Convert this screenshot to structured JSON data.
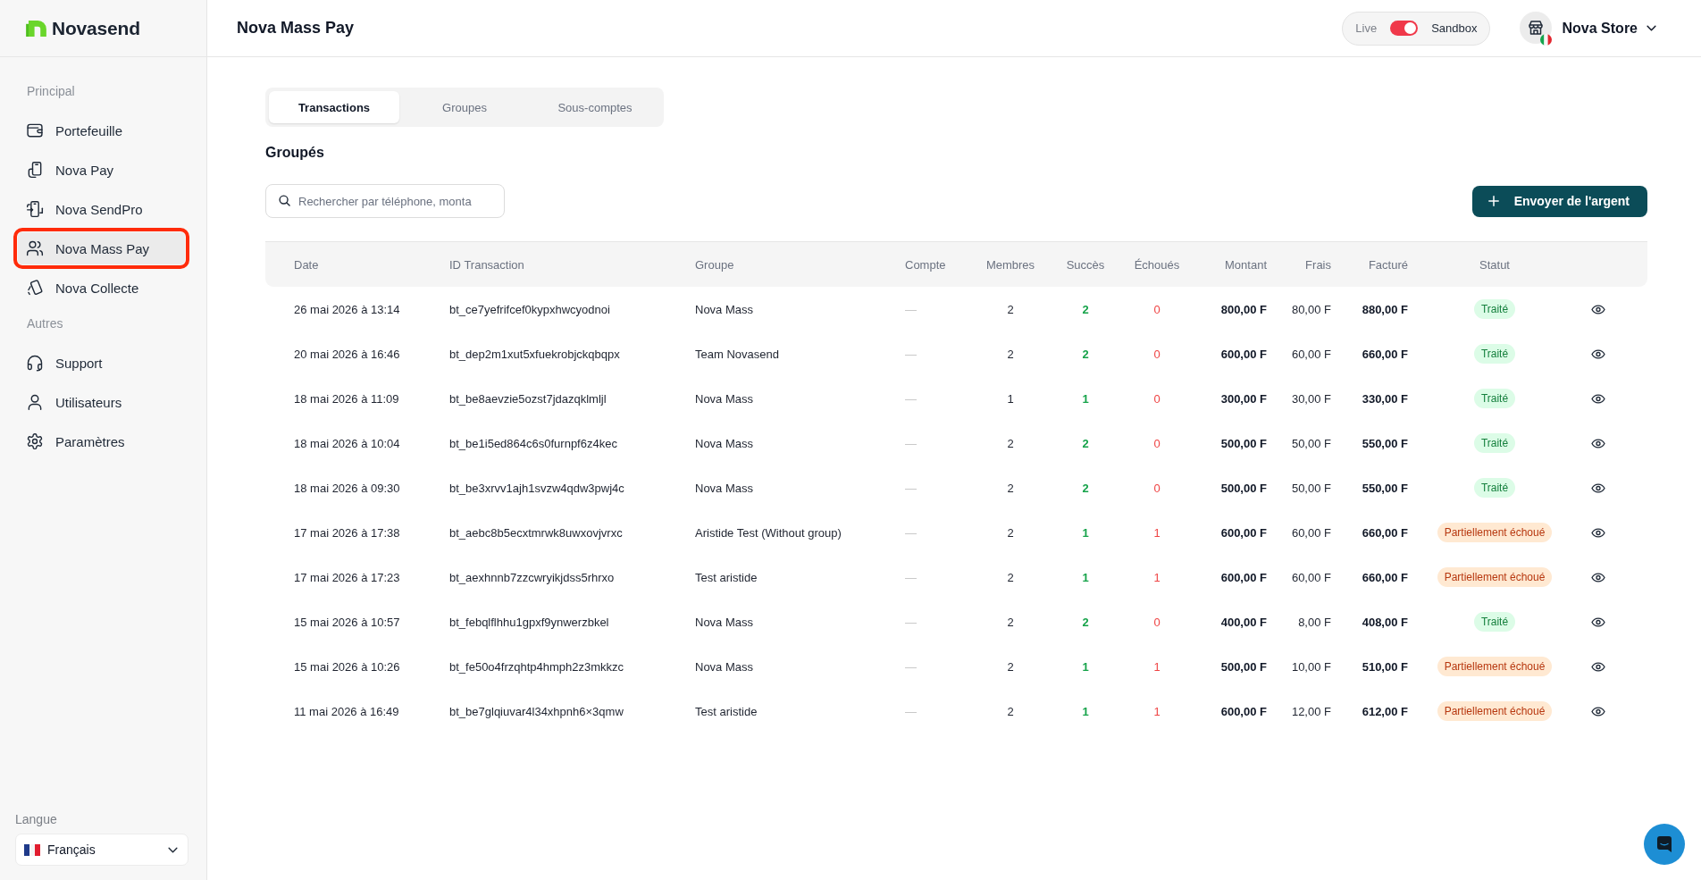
{
  "sidebar": {
    "logo": "Novasend",
    "sections": [
      {
        "label": "Principal",
        "items": [
          {
            "label": "Portefeuille",
            "selected": false
          },
          {
            "label": "Nova Pay",
            "selected": false
          },
          {
            "label": "Nova SendPro",
            "selected": false
          },
          {
            "label": "Nova Mass Pay",
            "selected": true
          },
          {
            "label": "Nova Collecte",
            "selected": false
          }
        ]
      },
      {
        "label": "Autres",
        "items": [
          {
            "label": "Support",
            "selected": false
          },
          {
            "label": "Utilisateurs",
            "selected": false
          },
          {
            "label": "Paramètres",
            "selected": false
          }
        ]
      }
    ],
    "language": {
      "label": "Langue",
      "value": "Français"
    }
  },
  "header": {
    "title": "Nova Mass Pay",
    "mode_switch": {
      "left_label": "Live",
      "right_label": "Sandbox",
      "on": true
    },
    "account": {
      "name": "Nova Store"
    }
  },
  "tabs": [
    {
      "label": "Transactions",
      "selected": true
    },
    {
      "label": "Groupes",
      "selected": false
    },
    {
      "label": "Sous-comptes",
      "selected": false
    }
  ],
  "section_title": "Groupés",
  "search": {
    "placeholder": "Rechercher par téléphone, monta"
  },
  "send_button": {
    "label": "Envoyer de l'argent"
  },
  "table": {
    "columns": [
      "Date",
      "ID Transaction",
      "Groupe",
      "Compte",
      "Membres",
      "Succès",
      "Échoués",
      "Montant",
      "Frais",
      "Facturé",
      "Statut"
    ],
    "rows": [
      {
        "date": "26 mai 2026 à 13:14",
        "id": "bt_ce7yefrifcef0kypxhwcyodnoi",
        "group": "Nova Mass",
        "account": "—",
        "members": "2",
        "success": "2",
        "failed": "0",
        "amount": "800,00 F",
        "fees": "80,00 F",
        "billed": "880,00 F",
        "status": {
          "label": "Traité",
          "kind": "success"
        }
      },
      {
        "date": "20 mai 2026 à 16:46",
        "id": "bt_dep2m1xut5xfuekrobjckqbqpx",
        "group": "Team Novasend",
        "account": "—",
        "members": "2",
        "success": "2",
        "failed": "0",
        "amount": "600,00 F",
        "fees": "60,00 F",
        "billed": "660,00 F",
        "status": {
          "label": "Traité",
          "kind": "success"
        }
      },
      {
        "date": "18 mai 2026 à 11:09",
        "id": "bt_be8aevzie5ozst7jdazqklmljl",
        "group": "Nova Mass",
        "account": "—",
        "members": "1",
        "success": "1",
        "failed": "0",
        "amount": "300,00 F",
        "fees": "30,00 F",
        "billed": "330,00 F",
        "status": {
          "label": "Traité",
          "kind": "success"
        }
      },
      {
        "date": "18 mai 2026 à 10:04",
        "id": "bt_be1i5ed864c6s0furnpf6z4kec",
        "group": "Nova Mass",
        "account": "—",
        "members": "2",
        "success": "2",
        "failed": "0",
        "amount": "500,00 F",
        "fees": "50,00 F",
        "billed": "550,00 F",
        "status": {
          "label": "Traité",
          "kind": "success"
        }
      },
      {
        "date": "18 mai 2026 à 09:30",
        "id": "bt_be3xrvv1ajh1svzw4qdw3pwj4c",
        "group": "Nova Mass",
        "account": "—",
        "members": "2",
        "success": "2",
        "failed": "0",
        "amount": "500,00 F",
        "fees": "50,00 F",
        "billed": "550,00 F",
        "status": {
          "label": "Traité",
          "kind": "success"
        }
      },
      {
        "date": "17 mai 2026 à 17:38",
        "id": "bt_aebc8b5ecxtmrwk8uwxovjvrxc",
        "group": "Aristide Test (Without group)",
        "account": "—",
        "members": "2",
        "success": "1",
        "failed": "1",
        "amount": "600,00 F",
        "fees": "60,00 F",
        "billed": "660,00 F",
        "status": {
          "label": "Partiellement échoué",
          "kind": "partial"
        }
      },
      {
        "date": "17 mai 2026 à 17:23",
        "id": "bt_aexhnnb7zzcwryikjdss5rhrxo",
        "group": "Test aristide",
        "account": "—",
        "members": "2",
        "success": "1",
        "failed": "1",
        "amount": "600,00 F",
        "fees": "60,00 F",
        "billed": "660,00 F",
        "status": {
          "label": "Partiellement échoué",
          "kind": "partial"
        }
      },
      {
        "date": "15 mai 2026 à 10:57",
        "id": "bt_febqlflhhu1gpxf9ynwerzbkel",
        "group": "Nova Mass",
        "account": "—",
        "members": "2",
        "success": "2",
        "failed": "0",
        "amount": "400,00 F",
        "fees": "8,00 F",
        "billed": "408,00 F",
        "status": {
          "label": "Traité",
          "kind": "success"
        }
      },
      {
        "date": "15 mai 2026 à 10:26",
        "id": "bt_fe50o4frzqhtp4hmph2z3mkkzc",
        "group": "Nova Mass",
        "account": "—",
        "members": "2",
        "success": "1",
        "failed": "1",
        "amount": "500,00 F",
        "fees": "10,00 F",
        "billed": "510,00 F",
        "status": {
          "label": "Partiellement échoué",
          "kind": "partial"
        }
      },
      {
        "date": "11 mai 2026 à 16:49",
        "id": "bt_be7glqiuvar4l34xhpnh6×3qmw",
        "group": "Test aristide",
        "account": "—",
        "members": "2",
        "success": "1",
        "failed": "1",
        "amount": "600,00 F",
        "fees": "12,00 F",
        "billed": "612,00 F",
        "status": {
          "label": "Partiellement échoué",
          "kind": "partial"
        }
      }
    ]
  }
}
